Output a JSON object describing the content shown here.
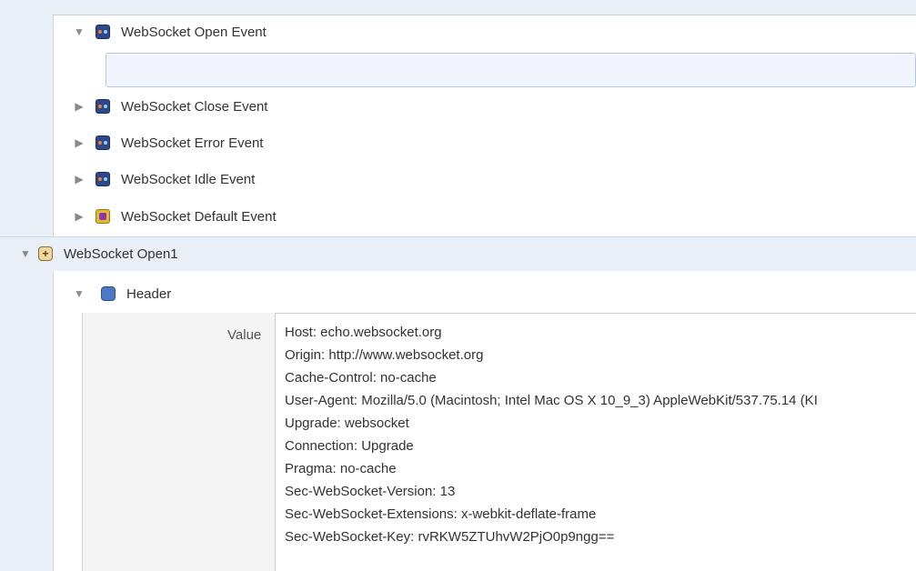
{
  "events": [
    {
      "label": "WebSocket Open Event",
      "expanded": true,
      "icon": "websocket-event-icon"
    },
    {
      "label": "WebSocket Close Event",
      "expanded": false,
      "icon": "websocket-event-icon"
    },
    {
      "label": "WebSocket Error Event",
      "expanded": false,
      "icon": "websocket-event-icon"
    },
    {
      "label": "WebSocket Idle Event",
      "expanded": false,
      "icon": "websocket-event-icon"
    },
    {
      "label": "WebSocket Default Event",
      "expanded": false,
      "icon": "default-event-icon"
    }
  ],
  "node": {
    "label": "WebSocket Open1",
    "icon": "websocket-step-icon"
  },
  "header": {
    "label": "Header",
    "value_label": "Value",
    "lines": [
      "Host: echo.websocket.org",
      "Origin: http://www.websocket.org",
      "Cache-Control: no-cache",
      "User-Agent: Mozilla/5.0 (Macintosh; Intel Mac OS X 10_9_3) AppleWebKit/537.75.14 (KI",
      "Upgrade: websocket",
      "Connection: Upgrade",
      "Pragma: no-cache",
      "Sec-WebSocket-Version: 13",
      "Sec-WebSocket-Extensions: x-webkit-deflate-frame",
      "Sec-WebSocket-Key: rvRKW5ZTUhvW2PjO0p9ngg=="
    ]
  },
  "colors": {
    "background": "#e9eff7",
    "panel": "#ffffff",
    "accent": "#2c4a8a"
  }
}
